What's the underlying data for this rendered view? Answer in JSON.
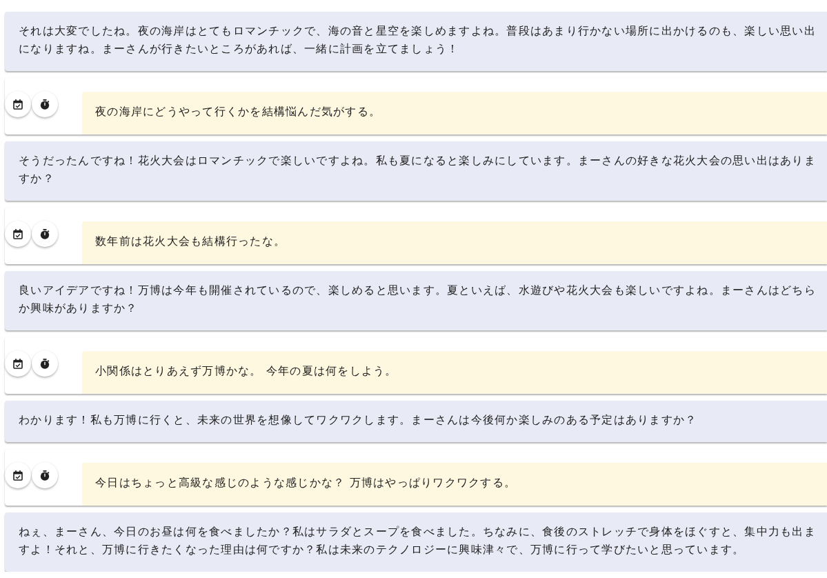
{
  "messages": [
    {
      "kind": "assistant",
      "text": "それは大変でしたね。夜の海岸はとてもロマンチックで、海の音と星空を楽しめますよね。普段はあまり行かない場所に出かけるのも、楽しい思い出になりますね。まーさんが行きたいところがあれば、一緒に計画を立てましょう！"
    },
    {
      "kind": "user",
      "text": "夜の海岸にどうやって行くかを結構悩んだ気がする。"
    },
    {
      "kind": "assistant",
      "text": "そうだったんですね！花火大会はロマンチックで楽しいですよね。私も夏になると楽しみにしています。まーさんの好きな花火大会の思い出はありますか？"
    },
    {
      "kind": "user",
      "text": "数年前は花火大会も結構行ったな。"
    },
    {
      "kind": "assistant",
      "text": "良いアイデアですね！万博は今年も開催されているので、楽しめると思います。夏といえば、水遊びや花火大会も楽しいですよね。まーさんはどちらか興味がありますか？"
    },
    {
      "kind": "user",
      "text": "小関係はとりあえず万博かな。 今年の夏は何をしよう。"
    },
    {
      "kind": "assistant",
      "text": "わかります！私も万博に行くと、未来の世界を想像してワクワクします。まーさんは今後何か楽しみのある予定はありますか？"
    },
    {
      "kind": "user",
      "text": "今日はちょっと高級な感じのような感じかな？ 万博はやっぱりワクワクする。"
    },
    {
      "kind": "assistant",
      "text": "ねぇ、まーさん、今日のお昼は何を食べましたか？私はサラダとスープを食べました。ちなみに、食後のストレッチで身体をほぐすと、集中力も出ますよ！それと、万博に行きたくなった理由は何ですか？私は未来のテクノロジーに興味津々で、万博に行って学びたいと思っています。"
    }
  ]
}
